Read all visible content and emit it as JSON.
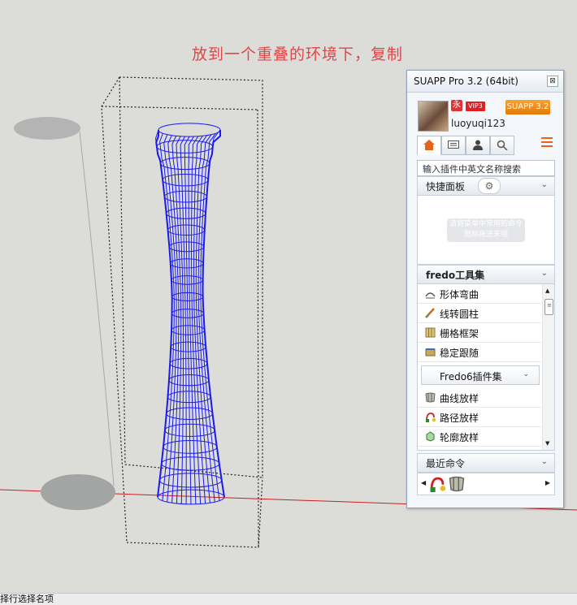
{
  "canvas": {
    "annotation": "放到一个重叠的环境下，复制",
    "colors": {
      "background": "#dcdcd9",
      "mesh": "#1a1af0",
      "axis_red": "#cc1e1e",
      "annotation": "#e04646"
    }
  },
  "status_bar": {
    "text": "择行选择名项"
  },
  "panel": {
    "title": "SUAPP Pro 3.2 (64bit)",
    "close_glyph": "⊠",
    "user": {
      "username": "luoyuqi123",
      "badge_k": "永",
      "badge_vip": "VIP3",
      "version_badge": "SUAPP 3.2"
    },
    "tabs": [
      {
        "icon": "home-icon",
        "active": true
      },
      {
        "icon": "monitor-icon",
        "active": false
      },
      {
        "icon": "user-icon",
        "active": false
      },
      {
        "icon": "search-icon",
        "active": false
      }
    ],
    "search_placeholder": "输入插件中英文名称搜索",
    "quick_panel": {
      "label": "快捷面板",
      "hint": "请将菜单中常用的命令图标拖进来哦"
    },
    "fredo_section": {
      "label": "fredo工具集",
      "items": [
        {
          "label": "形体弯曲",
          "icon": "bend-icon"
        },
        {
          "label": "线转圆柱",
          "icon": "line-to-cylinder-icon"
        },
        {
          "label": "栅格框架",
          "icon": "grid-frame-icon"
        },
        {
          "label": "稳定跟随",
          "icon": "follow-icon"
        }
      ],
      "subgroup_label": "Fredo6插件集",
      "sub_items": [
        {
          "label": "曲线放样",
          "icon": "curve-loft-icon"
        },
        {
          "label": "路径放样",
          "icon": "path-loft-icon"
        },
        {
          "label": "轮廓放样",
          "icon": "profile-loft-icon"
        }
      ]
    },
    "recent": {
      "label": "最近命令",
      "items": [
        {
          "icon": "path-loft-icon"
        },
        {
          "icon": "curve-loft-icon"
        }
      ]
    }
  }
}
